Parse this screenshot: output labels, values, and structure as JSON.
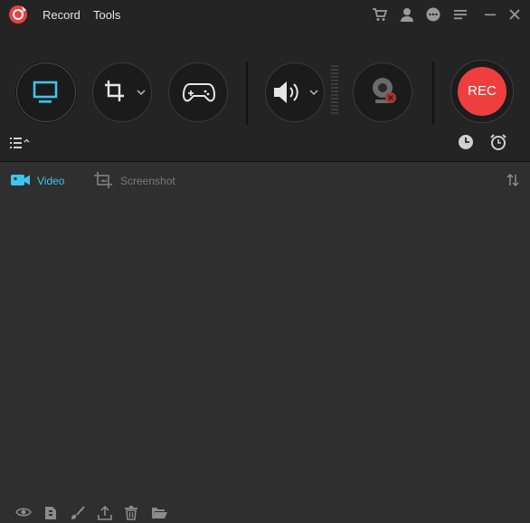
{
  "window": {
    "menu": {
      "record_label": "Record",
      "tools_label": "Tools"
    }
  },
  "toolbar": {
    "record_button_label": "REC"
  },
  "tabs": [
    {
      "label": "Video",
      "active": true
    },
    {
      "label": "Screenshot",
      "active": false
    }
  ],
  "colors": {
    "accent": "#3fc4ee",
    "rec_red": "#ef3e3e",
    "background": "#2f2f2f",
    "toolbar_bg": "#242424"
  }
}
